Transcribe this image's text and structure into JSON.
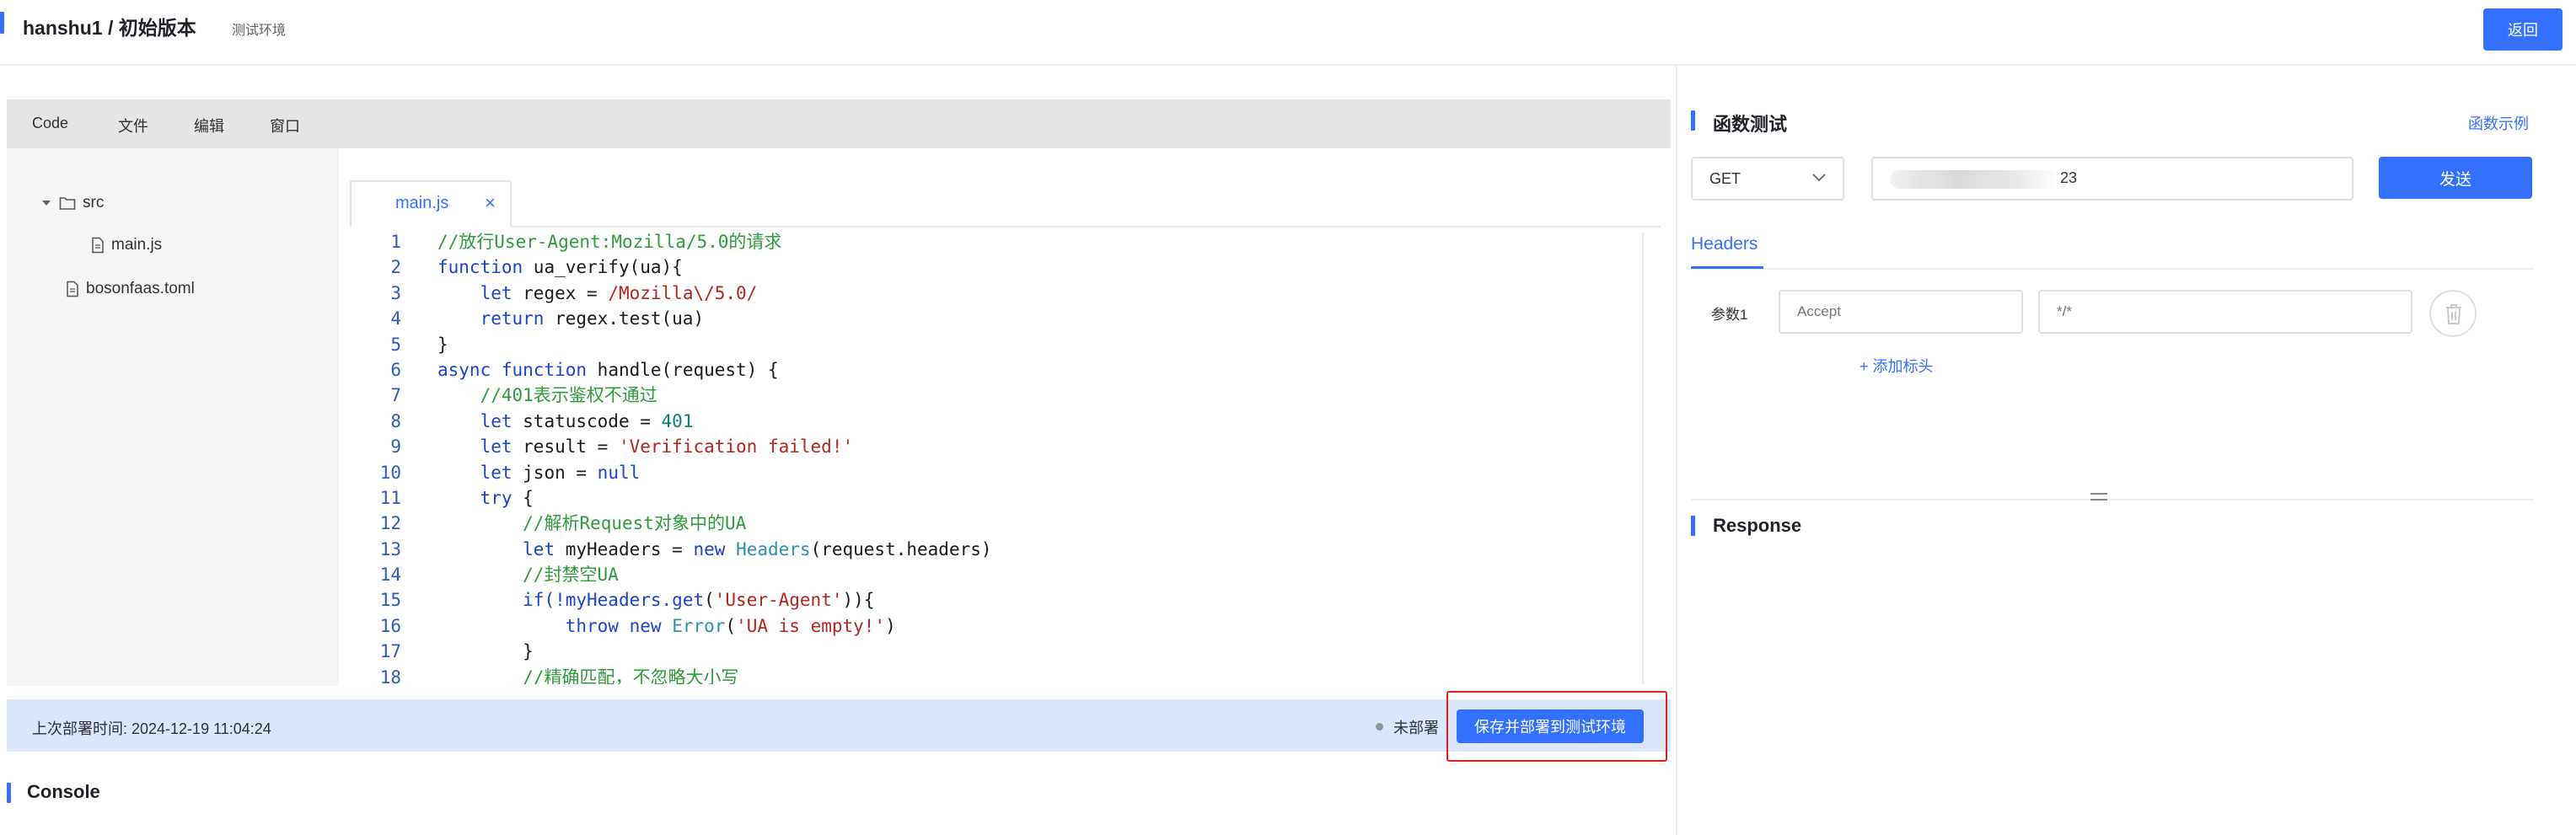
{
  "header": {
    "title": "hanshu1 / 初始版本",
    "env": "测试环境",
    "back_label": "返回"
  },
  "menu": {
    "items": [
      "Code",
      "文件",
      "编辑",
      "窗口"
    ]
  },
  "file_tree": {
    "folder": "src",
    "folder_file": "main.js",
    "root_file": "bosonfaas.toml"
  },
  "editor": {
    "tab_label": "main.js",
    "tab_close": "×",
    "line_numbers": [
      "1",
      "2",
      "3",
      "4",
      "5",
      "6",
      "7",
      "8",
      "9",
      "10",
      "11",
      "12",
      "13",
      "14",
      "15",
      "16",
      "17",
      "18"
    ],
    "tokens": {
      "l1_comment": "//放行User-Agent:Mozilla/5.0的请求",
      "kw_function": "function",
      "l2_rest": " ua_verify(ua){",
      "kw_let": "let",
      "l3_mid": " regex = ",
      "l3_regex": "/Mozilla\\/5.0/",
      "kw_return": "return",
      "l4_rest": " regex.test(ua)",
      "l5": "}",
      "kw_async": "async",
      "l6_rest": " handle(request) {",
      "l7_comment": "//401表示鉴权不通过",
      "l8_mid": " statuscode = ",
      "l8_num": "401",
      "l9_mid": " result = ",
      "l9_str": "'Verification failed!'",
      "l10_mid": " json = ",
      "kw_null": "null",
      "kw_try": "try",
      "l11_rest": " {",
      "l12_comment": "//解析Request对象中的UA",
      "l13_mid": " myHeaders = ",
      "kw_new": "new",
      "l13_type": "Headers",
      "l13_rest": "(request.headers)",
      "l14_comment": "//封禁空UA",
      "l15_a": "if(!myHeaders.",
      "l15_get": "get",
      "l15_b": "(",
      "l15_str": "'User-Agent'",
      "l15_c": ")){",
      "kw_throw": "throw",
      "l16_type": "Error",
      "l16_a": "(",
      "l16_str": "'UA is empty!'",
      "l16_b": ")",
      "l17": "}",
      "l18_comment": "//精确匹配，不忽略大小写"
    }
  },
  "deploy": {
    "last_time": "上次部署时间: 2024-12-19 11:04:24",
    "status": "未部署",
    "button": "保存并部署到测试环境"
  },
  "console": {
    "title": "Console"
  },
  "test_panel": {
    "title": "函数测试",
    "example_link": "函数示例",
    "method": "GET",
    "url_suffix": "23",
    "send_label": "发送",
    "tab_headers": "Headers",
    "param_label": "参数1",
    "header_key_placeholder": "Accept",
    "header_value_placeholder": "*/*",
    "add_header": "+ 添加标头",
    "response_title": "Response"
  },
  "colors": {
    "accent": "#3370ff",
    "highlight": "#e02020",
    "deploy_bar": "#dbe5fb"
  }
}
